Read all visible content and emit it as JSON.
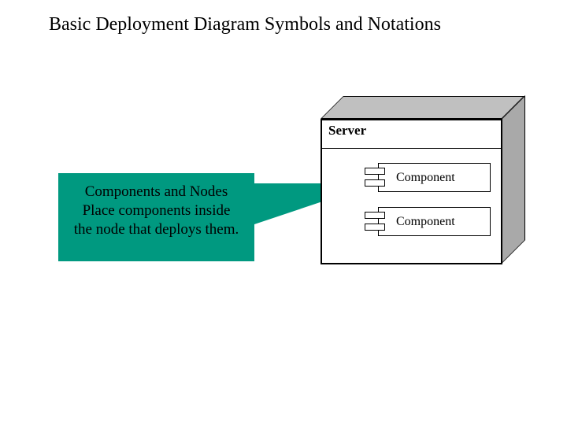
{
  "title": "Basic Deployment Diagram Symbols and Notations",
  "callout": {
    "heading": "Components and Nodes",
    "line1": "Place components inside",
    "line2": "the node that deploys them."
  },
  "node": {
    "label": "Server"
  },
  "components": [
    {
      "label": "Component"
    },
    {
      "label": "Component"
    }
  ]
}
